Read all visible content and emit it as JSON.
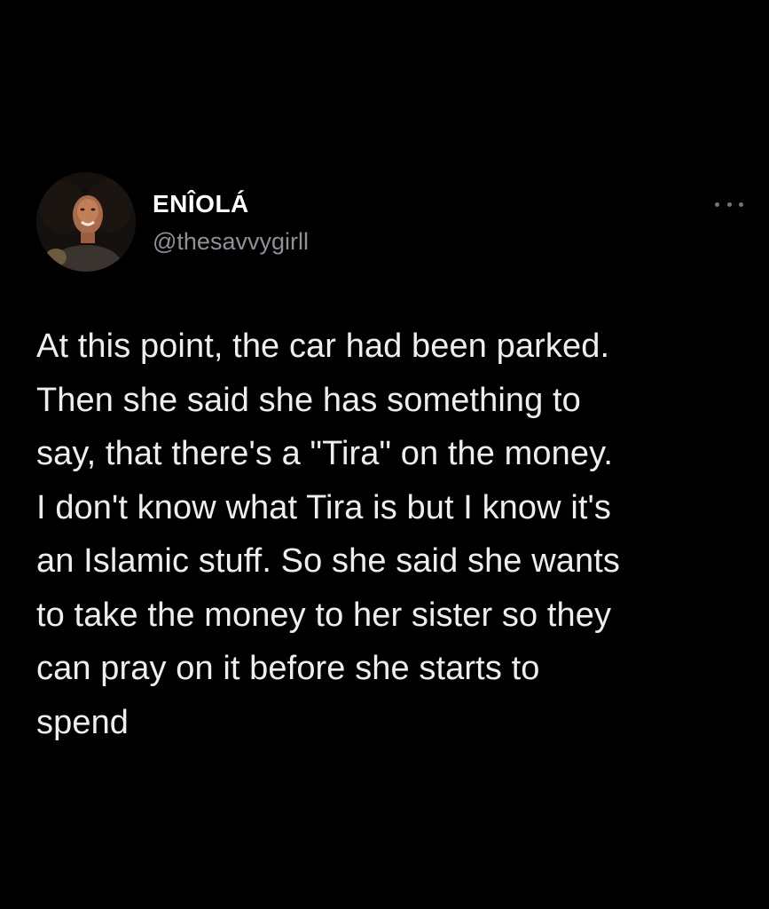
{
  "tweet": {
    "author": {
      "display_name": "ENÎOLÁ",
      "handle": "@thesavvygirll",
      "avatar_icon": "profile-photo"
    },
    "more_icon": "more-horizontal-icon",
    "text_lines": [
      "At this point, the car had been parked.",
      "Then she said she has something to",
      "say, that there's a \"Tira\" on the money.",
      "I don't know what Tira is but I know it's",
      "an Islamic stuff. So she said she wants",
      "to take the money to her sister so they",
      "can pray on it before she starts to",
      "spend"
    ]
  },
  "colors": {
    "background": "#000000",
    "text": "#eeeeee",
    "name": "#ffffff",
    "handle": "#8b9197"
  }
}
